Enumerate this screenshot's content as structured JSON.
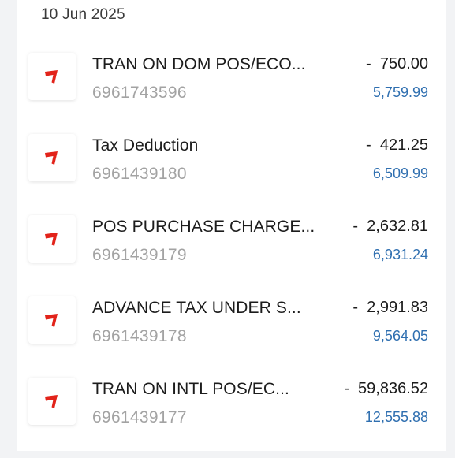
{
  "statement": {
    "date_header": "10 Jun 2025",
    "transactions": [
      {
        "title": "TRAN ON DOM POS/ECO...",
        "reference": "6961743596",
        "amount": "-  750.00",
        "balance": "5,759.99",
        "icon": "debit-arrow-icon"
      },
      {
        "title": "Tax Deduction",
        "reference": "6961439180",
        "amount": "-  421.25",
        "balance": "6,509.99",
        "icon": "debit-arrow-icon"
      },
      {
        "title": "POS PURCHASE CHARGE...",
        "reference": "6961439179",
        "amount": "-  2,632.81",
        "balance": "6,931.24",
        "icon": "debit-arrow-icon"
      },
      {
        "title": "ADVANCE TAX UNDER S...",
        "reference": "6961439178",
        "amount": "-  2,991.83",
        "balance": "9,564.05",
        "icon": "debit-arrow-icon"
      },
      {
        "title": "TRAN ON INTL POS/EC...",
        "reference": "6961439177",
        "amount": "-  59,836.52",
        "balance": "12,555.88",
        "icon": "debit-arrow-icon"
      }
    ]
  },
  "colors": {
    "debit_icon": "#e2231a",
    "balance_text": "#2f6fb0",
    "reference_text": "#a3a3a3"
  }
}
